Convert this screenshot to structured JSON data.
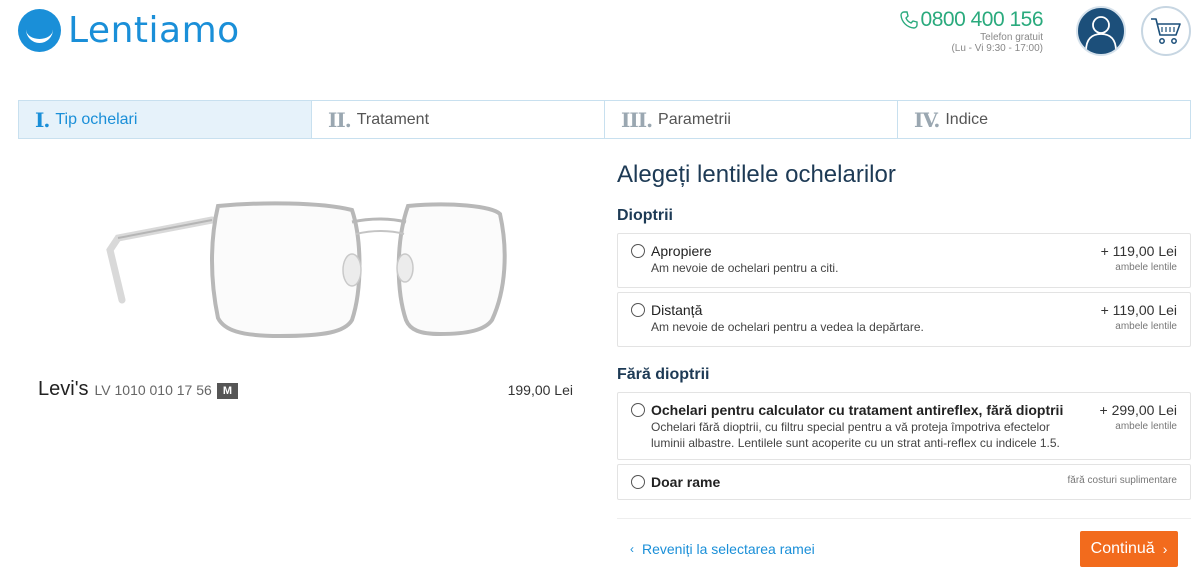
{
  "brand": {
    "name": "Lentiamo",
    "color": "#1a8fd8"
  },
  "contact": {
    "phone": "0800 400 156",
    "phone_label": "Telefon gratuit",
    "hours": "(Lu - Vi 9:30 - 17:00)",
    "icon": "phone-icon"
  },
  "header_icons": {
    "account": "user-icon",
    "cart": "cart-icon"
  },
  "steps": [
    {
      "num": "I.",
      "label": "Tip ochelari",
      "active": true
    },
    {
      "num": "II.",
      "label": "Tratament",
      "active": false
    },
    {
      "num": "III.",
      "label": "Parametrii",
      "active": false
    },
    {
      "num": "IV.",
      "label": "Indice",
      "active": false
    }
  ],
  "product": {
    "brand": "Levi's",
    "model": "LV 1010 010 17 56",
    "size": "M",
    "price": "199,00 Lei"
  },
  "panel": {
    "heading": "Alegeți lentilele ochelarilor",
    "sections": [
      {
        "label": "Dioptrii",
        "options": [
          {
            "title": "Apropiere",
            "desc": "Am nevoie de ochelari pentru a citi.",
            "price": "+ 119,00 Lei",
            "note": "ambele lentile"
          },
          {
            "title": "Distanță",
            "desc": "Am nevoie de ochelari pentru a vedea la depărtare.",
            "price": "+ 119,00 Lei",
            "note": "ambele lentile"
          }
        ]
      },
      {
        "label": "Fără dioptrii",
        "options": [
          {
            "title": "Ochelari pentru calculator cu tratament antireflex, fără dioptrii",
            "desc": "Ochelari fără dioptrii, cu filtru special pentru a vă proteja împotriva efectelor luminii albastre. Lentilele sunt acoperite cu un strat anti-reflex cu indicele 1.5.",
            "price": "+ 299,00 Lei",
            "note": "ambele lentile"
          },
          {
            "title": "Doar rame",
            "desc": "",
            "price": "",
            "note": "fără costuri suplimentare"
          }
        ]
      }
    ]
  },
  "actions": {
    "back": "Reveniți la selectarea ramei",
    "continue": "Continuă",
    "continue_color": "#f26b1d"
  }
}
